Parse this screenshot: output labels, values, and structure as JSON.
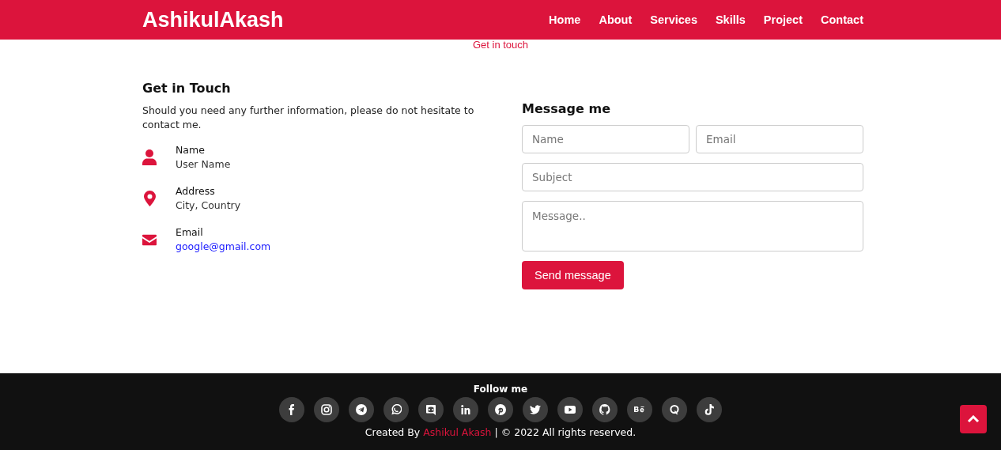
{
  "navbar": {
    "brand": "AshikulAkash",
    "links": [
      {
        "label": "Home"
      },
      {
        "label": "About"
      },
      {
        "label": "Services"
      },
      {
        "label": "Skills"
      },
      {
        "label": "Project"
      },
      {
        "label": "Contact"
      }
    ]
  },
  "section_title": "Get in touch",
  "contact_info": {
    "heading": "Get in Touch",
    "intro": "Should you need any further information, please do not hesitate to contact me.",
    "items": [
      {
        "kind": "person",
        "label": "Name",
        "value": "User Name",
        "link": false
      },
      {
        "kind": "pin",
        "label": "Address",
        "value": "City, Country",
        "link": false
      },
      {
        "kind": "mail",
        "label": "Email",
        "value": "google@gmail.com",
        "link": true
      }
    ]
  },
  "message_form": {
    "heading": "Message me",
    "rows": [
      [
        {
          "kind": "input",
          "placeholder": "Name"
        },
        {
          "kind": "input",
          "placeholder": "Email"
        }
      ],
      [
        {
          "kind": "input",
          "placeholder": "Subject"
        }
      ],
      [
        {
          "kind": "textarea",
          "placeholder": "Message.."
        }
      ]
    ],
    "button": "Send message"
  },
  "footer": {
    "heading": "Follow me",
    "social": [
      {
        "kind": "facebook"
      },
      {
        "kind": "instagram"
      },
      {
        "kind": "telegram"
      },
      {
        "kind": "whatsapp"
      },
      {
        "kind": "discord"
      },
      {
        "kind": "linkedin"
      },
      {
        "kind": "pinterest"
      },
      {
        "kind": "twitter"
      },
      {
        "kind": "youtube"
      },
      {
        "kind": "github"
      },
      {
        "kind": "behance"
      },
      {
        "kind": "quora"
      },
      {
        "kind": "tiktok"
      }
    ],
    "credit": "Created By ",
    "author": "Ashikul Akash",
    "rights": " | © 2022 All rights reserved."
  },
  "scroll_top": {
    "kind": "up"
  }
}
